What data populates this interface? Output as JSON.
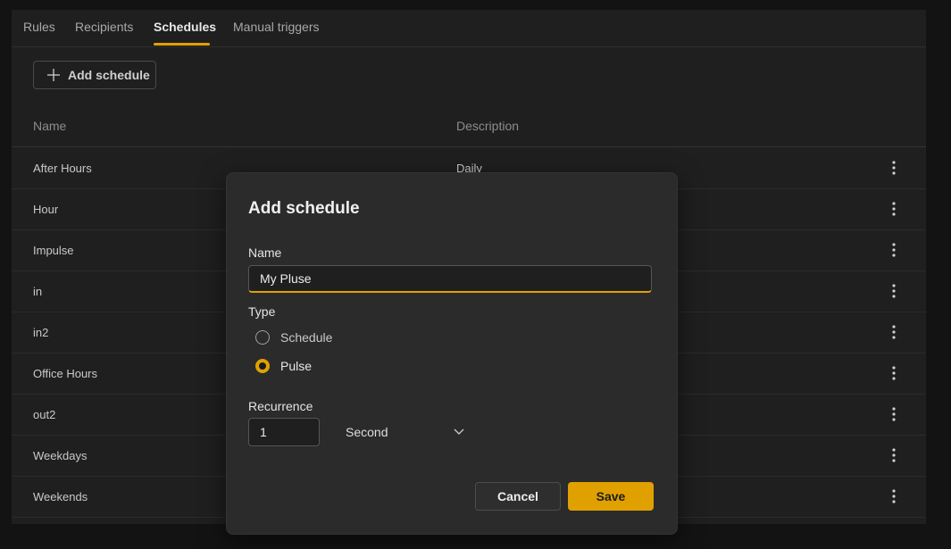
{
  "tabs": [
    {
      "label": "Rules"
    },
    {
      "label": "Recipients"
    },
    {
      "label": "Schedules",
      "active": true
    },
    {
      "label": "Manual triggers"
    }
  ],
  "toolbar": {
    "add_label": "Add schedule",
    "add_icon": "plus-icon"
  },
  "table": {
    "columns": [
      "Name",
      "Description"
    ],
    "rows": [
      {
        "name": "After Hours",
        "description": "Daily"
      },
      {
        "name": "Hour",
        "description": ""
      },
      {
        "name": "Impulse",
        "description": ""
      },
      {
        "name": "in",
        "description": ""
      },
      {
        "name": "in2",
        "description": ""
      },
      {
        "name": "Office Hours",
        "description": ""
      },
      {
        "name": "out2",
        "description": ""
      },
      {
        "name": "Weekdays",
        "description": ""
      },
      {
        "name": "Weekends",
        "description": ""
      }
    ],
    "row_menu_icon": "more-vertical-icon"
  },
  "dialog": {
    "title": "Add schedule",
    "name_label": "Name",
    "name_value": "My Pluse",
    "type_label": "Type",
    "type_options": [
      {
        "label": "Schedule",
        "selected": false
      },
      {
        "label": "Pulse",
        "selected": true
      }
    ],
    "recurrence_label": "Recurrence",
    "recurrence_value": "1",
    "recurrence_unit": "Second",
    "cancel_label": "Cancel",
    "save_label": "Save"
  },
  "colors": {
    "accent": "#e0a100",
    "background": "#1f1f1f",
    "dialog": "#2b2b2b"
  }
}
